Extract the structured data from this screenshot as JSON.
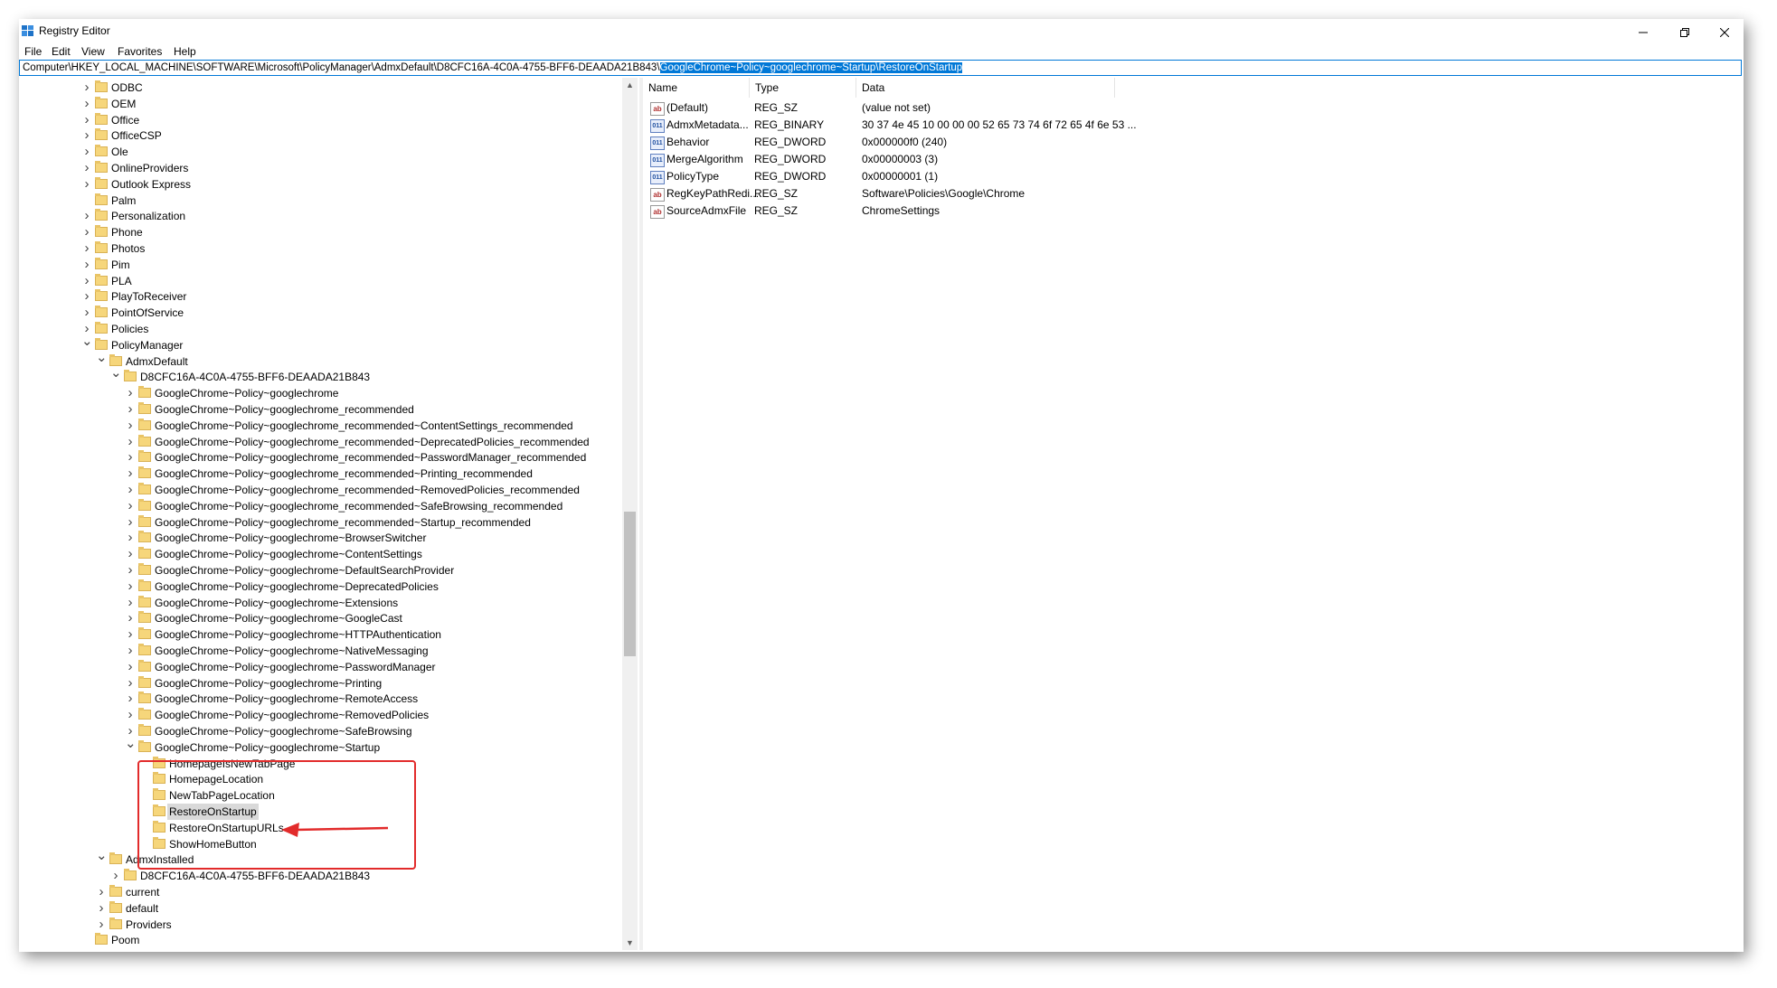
{
  "window": {
    "title": "Registry Editor"
  },
  "menu": [
    "File",
    "Edit",
    "View",
    "Favorites",
    "Help"
  ],
  "address": {
    "prefix": "Computer\\HKEY_LOCAL_MACHINE\\SOFTWARE\\Microsoft\\PolicyManager\\AdmxDefault\\D8CFC16A-4C0A-4755-BFF6-DEAADA21B843\\",
    "selected": "GoogleChrome~Policy~googlechrome~Startup\\RestoreOnStartup"
  },
  "tree": [
    {
      "label": "ODBC",
      "level": 0,
      "chev": ">"
    },
    {
      "label": "OEM",
      "level": 0,
      "chev": ">"
    },
    {
      "label": "Office",
      "level": 0,
      "chev": ">"
    },
    {
      "label": "OfficeCSP",
      "level": 0,
      "chev": ">"
    },
    {
      "label": "Ole",
      "level": 0,
      "chev": ">"
    },
    {
      "label": "OnlineProviders",
      "level": 0,
      "chev": ">"
    },
    {
      "label": "Outlook Express",
      "level": 0,
      "chev": ">"
    },
    {
      "label": "Palm",
      "level": 0,
      "chev": ""
    },
    {
      "label": "Personalization",
      "level": 0,
      "chev": ">"
    },
    {
      "label": "Phone",
      "level": 0,
      "chev": ">"
    },
    {
      "label": "Photos",
      "level": 0,
      "chev": ">"
    },
    {
      "label": "Pim",
      "level": 0,
      "chev": ">"
    },
    {
      "label": "PLA",
      "level": 0,
      "chev": ">"
    },
    {
      "label": "PlayToReceiver",
      "level": 0,
      "chev": ">"
    },
    {
      "label": "PointOfService",
      "level": 0,
      "chev": ">"
    },
    {
      "label": "Policies",
      "level": 0,
      "chev": ">"
    },
    {
      "label": "PolicyManager",
      "level": 0,
      "chev": "v"
    },
    {
      "label": "AdmxDefault",
      "level": 1,
      "chev": "v"
    },
    {
      "label": "D8CFC16A-4C0A-4755-BFF6-DEAADA21B843",
      "level": 2,
      "chev": "v"
    },
    {
      "label": "GoogleChrome~Policy~googlechrome",
      "level": 3,
      "chev": ">"
    },
    {
      "label": "GoogleChrome~Policy~googlechrome_recommended",
      "level": 3,
      "chev": ">"
    },
    {
      "label": "GoogleChrome~Policy~googlechrome_recommended~ContentSettings_recommended",
      "level": 3,
      "chev": ">"
    },
    {
      "label": "GoogleChrome~Policy~googlechrome_recommended~DeprecatedPolicies_recommended",
      "level": 3,
      "chev": ">"
    },
    {
      "label": "GoogleChrome~Policy~googlechrome_recommended~PasswordManager_recommended",
      "level": 3,
      "chev": ">"
    },
    {
      "label": "GoogleChrome~Policy~googlechrome_recommended~Printing_recommended",
      "level": 3,
      "chev": ">"
    },
    {
      "label": "GoogleChrome~Policy~googlechrome_recommended~RemovedPolicies_recommended",
      "level": 3,
      "chev": ">"
    },
    {
      "label": "GoogleChrome~Policy~googlechrome_recommended~SafeBrowsing_recommended",
      "level": 3,
      "chev": ">"
    },
    {
      "label": "GoogleChrome~Policy~googlechrome_recommended~Startup_recommended",
      "level": 3,
      "chev": ">"
    },
    {
      "label": "GoogleChrome~Policy~googlechrome~BrowserSwitcher",
      "level": 3,
      "chev": ">"
    },
    {
      "label": "GoogleChrome~Policy~googlechrome~ContentSettings",
      "level": 3,
      "chev": ">"
    },
    {
      "label": "GoogleChrome~Policy~googlechrome~DefaultSearchProvider",
      "level": 3,
      "chev": ">"
    },
    {
      "label": "GoogleChrome~Policy~googlechrome~DeprecatedPolicies",
      "level": 3,
      "chev": ">"
    },
    {
      "label": "GoogleChrome~Policy~googlechrome~Extensions",
      "level": 3,
      "chev": ">"
    },
    {
      "label": "GoogleChrome~Policy~googlechrome~GoogleCast",
      "level": 3,
      "chev": ">"
    },
    {
      "label": "GoogleChrome~Policy~googlechrome~HTTPAuthentication",
      "level": 3,
      "chev": ">"
    },
    {
      "label": "GoogleChrome~Policy~googlechrome~NativeMessaging",
      "level": 3,
      "chev": ">"
    },
    {
      "label": "GoogleChrome~Policy~googlechrome~PasswordManager",
      "level": 3,
      "chev": ">"
    },
    {
      "label": "GoogleChrome~Policy~googlechrome~Printing",
      "level": 3,
      "chev": ">"
    },
    {
      "label": "GoogleChrome~Policy~googlechrome~RemoteAccess",
      "level": 3,
      "chev": ">"
    },
    {
      "label": "GoogleChrome~Policy~googlechrome~RemovedPolicies",
      "level": 3,
      "chev": ">"
    },
    {
      "label": "GoogleChrome~Policy~googlechrome~SafeBrowsing",
      "level": 3,
      "chev": ">"
    },
    {
      "label": "GoogleChrome~Policy~googlechrome~Startup",
      "level": 3,
      "chev": "v"
    },
    {
      "label": "HomepageIsNewTabPage",
      "level": 4,
      "chev": ""
    },
    {
      "label": "HomepageLocation",
      "level": 4,
      "chev": ""
    },
    {
      "label": "NewTabPageLocation",
      "level": 4,
      "chev": ""
    },
    {
      "label": "RestoreOnStartup",
      "level": 4,
      "chev": "",
      "selected": true
    },
    {
      "label": "RestoreOnStartupURLs",
      "level": 4,
      "chev": ""
    },
    {
      "label": "ShowHomeButton",
      "level": 4,
      "chev": ""
    },
    {
      "label": "AdmxInstalled",
      "level": 1,
      "chev": "v"
    },
    {
      "label": "D8CFC16A-4C0A-4755-BFF6-DEAADA21B843",
      "level": 2,
      "chev": ">"
    },
    {
      "label": "current",
      "level": 1,
      "chev": ">"
    },
    {
      "label": "default",
      "level": 1,
      "chev": ">"
    },
    {
      "label": "Providers",
      "level": 1,
      "chev": ">"
    },
    {
      "label": "Poom",
      "level": 0,
      "chev": ""
    }
  ],
  "columns": {
    "name": "Name",
    "type": "Type",
    "data": "Data"
  },
  "values": [
    {
      "icon": "string-value-icon",
      "kind": "sz",
      "name": "(Default)",
      "type": "REG_SZ",
      "data": "(value not set)"
    },
    {
      "icon": "binary-value-icon",
      "kind": "bin",
      "name": "AdmxMetadata...",
      "type": "REG_BINARY",
      "data": "30 37 4e 45 10 00 00 00 52 65 73 74 6f 72 65 4f 6e 53 ..."
    },
    {
      "icon": "binary-value-icon",
      "kind": "bin",
      "name": "Behavior",
      "type": "REG_DWORD",
      "data": "0x000000f0 (240)"
    },
    {
      "icon": "binary-value-icon",
      "kind": "bin",
      "name": "MergeAlgorithm",
      "type": "REG_DWORD",
      "data": "0x00000003 (3)"
    },
    {
      "icon": "binary-value-icon",
      "kind": "bin",
      "name": "PolicyType",
      "type": "REG_DWORD",
      "data": "0x00000001 (1)"
    },
    {
      "icon": "string-value-icon",
      "kind": "sz",
      "name": "RegKeyPathRedi...",
      "type": "REG_SZ",
      "data": "Software\\Policies\\Google\\Chrome"
    },
    {
      "icon": "string-value-icon",
      "kind": "sz",
      "name": "SourceAdmxFile",
      "type": "REG_SZ",
      "data": "ChromeSettings"
    }
  ],
  "colors": {
    "selection": "#0078d7",
    "annotation": "#e22b2b",
    "folder": "#f6d67b"
  }
}
